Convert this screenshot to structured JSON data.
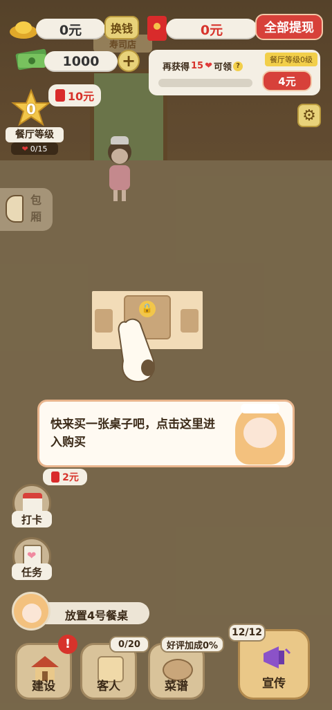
{
  "header": {
    "gold_value": "0元",
    "exchange_label": "换钱",
    "redpacket_value": "0元",
    "withdraw_all_label": "全部提现",
    "cash_value": "1000"
  },
  "quest_panel": {
    "prefix": "再获得",
    "count": "15",
    "suffix": "可领",
    "level_tag": "餐厅等级0级",
    "reward_label": "4元",
    "progress": 0
  },
  "level_badge": {
    "level": "0",
    "title": "餐厅等级",
    "hearts": "0/15",
    "reward": "10元"
  },
  "side_left": {
    "room_label": "包厢"
  },
  "scene": {
    "shop_sign": "寿司店"
  },
  "tutorial": {
    "message": "快来买一张桌子吧，点击这里进入购买"
  },
  "side_buttons": {
    "checkin_reward": "2元",
    "checkin_label": "打卡",
    "task_label": "任务"
  },
  "task_hint": {
    "text": "放置4号餐桌"
  },
  "bottom_bar": {
    "build_label": "建设",
    "guests_label": "客人",
    "guests_count": "0/20",
    "menu_label": "菜谱",
    "rating_label": "好评加成0%",
    "promo_label": "宣传",
    "promo_count": "12/12"
  },
  "colors": {
    "accent_red": "#d7413a",
    "gold": "#e8d27a",
    "panel_bg": "#f4efe4"
  }
}
